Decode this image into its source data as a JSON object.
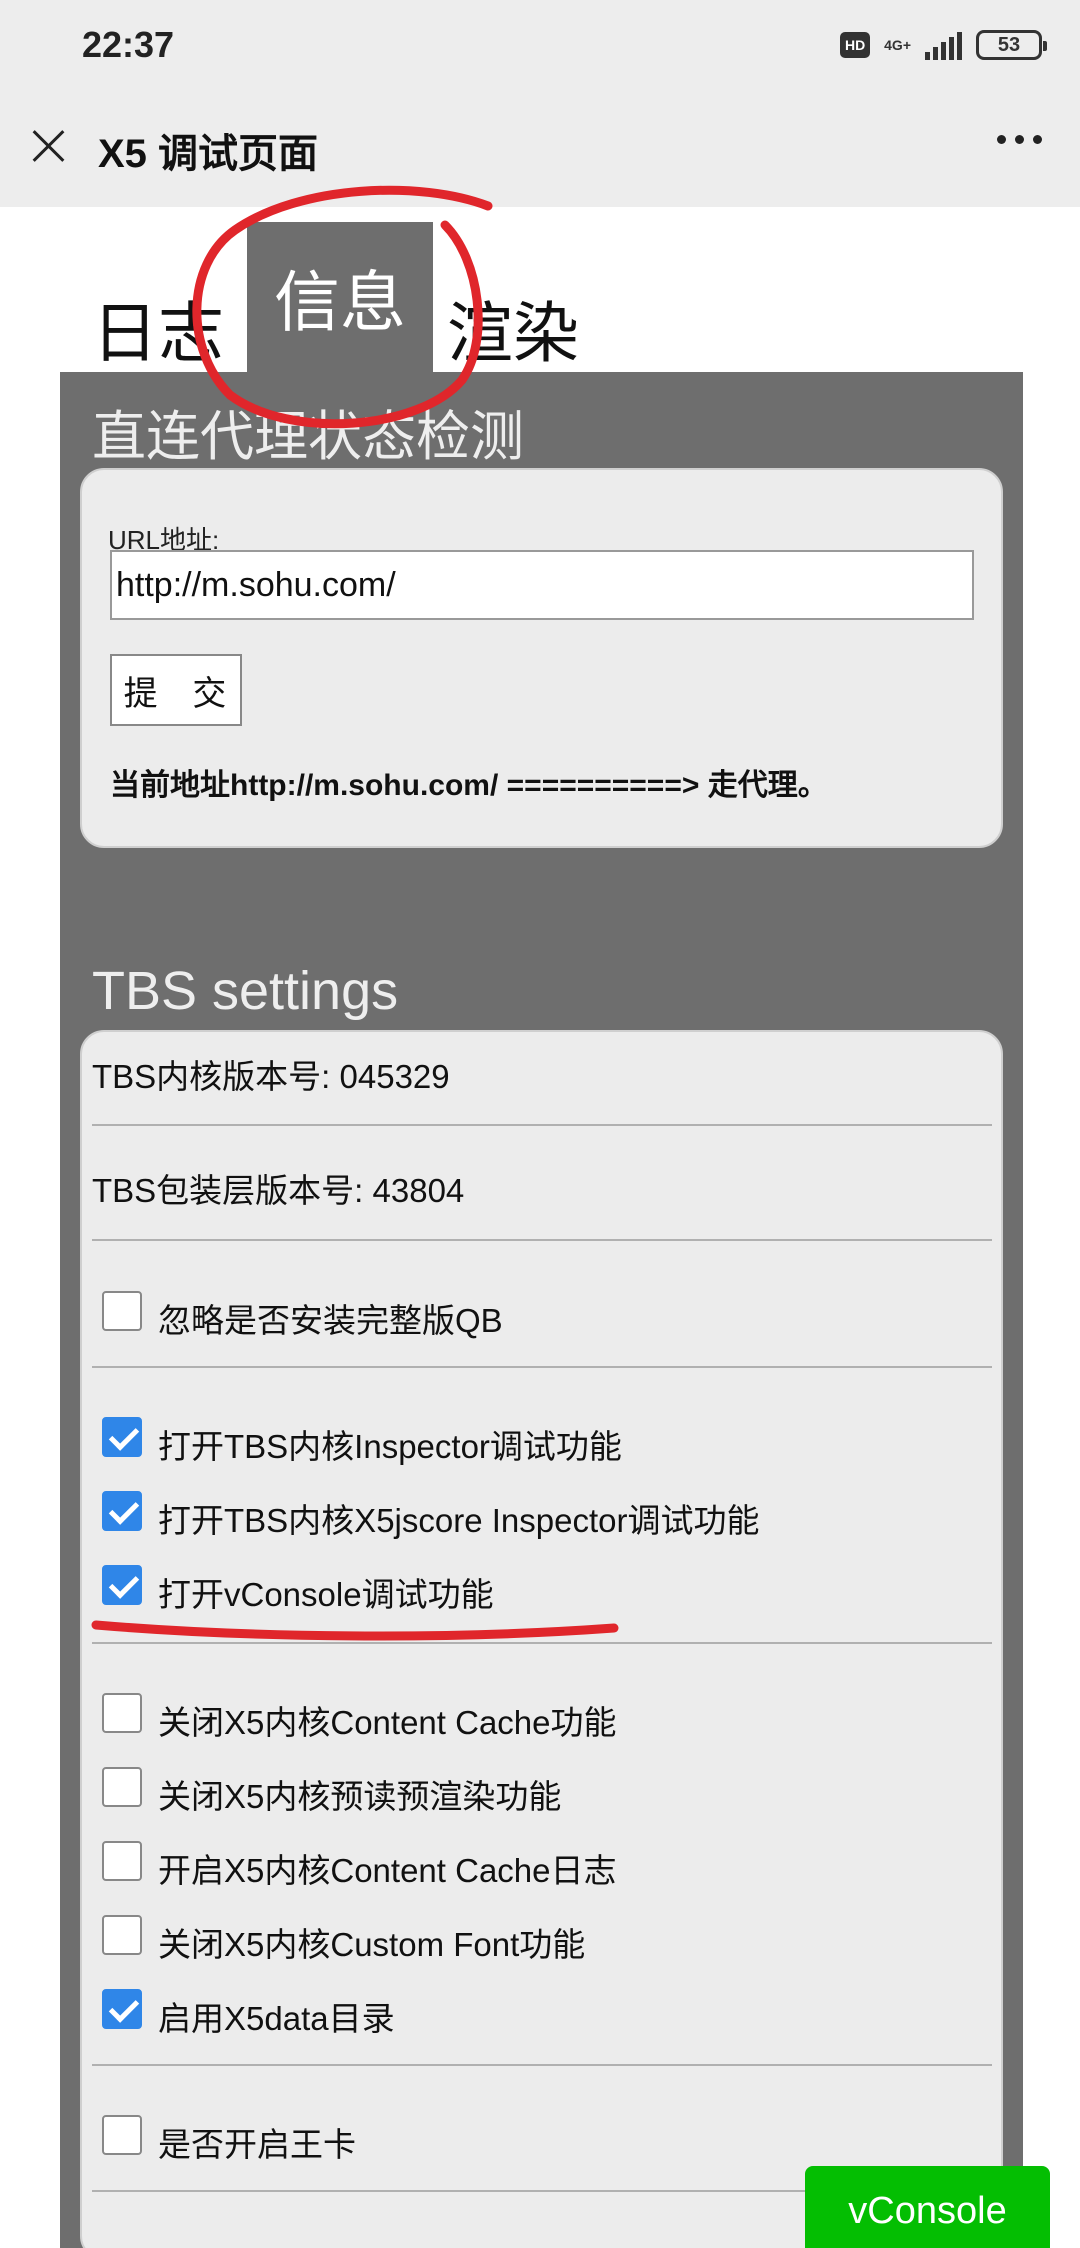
{
  "status_bar": {
    "time": "22:37",
    "hd": "HD",
    "network": "4G+",
    "battery": "53"
  },
  "titlebar": {
    "title": "X5 调试页面",
    "close_icon": "close-icon",
    "more_icon": "more-dots-icon"
  },
  "tabs": [
    {
      "label": "日志",
      "active": false
    },
    {
      "label": "信息",
      "active": true
    },
    {
      "label": "渲染",
      "active": false
    }
  ],
  "proxy_section": {
    "title": "直连代理状态检测",
    "url_label": "URL地址:",
    "url_value": "http://m.sohu.com/",
    "submit_label": "提 交",
    "result": "当前地址http://m.sohu.com/ ==========> 走代理。"
  },
  "tbs_section": {
    "title": "TBS settings",
    "core_version": "TBS内核版本号: 045329",
    "wrapper_version": "TBS包装层版本号: 43804",
    "group1": [
      {
        "label": "忽略是否安装完整版QB",
        "checked": false
      }
    ],
    "group2": [
      {
        "label": "打开TBS内核Inspector调试功能",
        "checked": true
      },
      {
        "label": "打开TBS内核X5jscore Inspector调试功能",
        "checked": true
      },
      {
        "label": "打开vConsole调试功能",
        "checked": true
      }
    ],
    "group3": [
      {
        "label": "关闭X5内核Content Cache功能",
        "checked": false
      },
      {
        "label": "关闭X5内核预读预渲染功能",
        "checked": false
      },
      {
        "label": "开启X5内核Content Cache日志",
        "checked": false
      },
      {
        "label": "关闭X5内核Custom Font功能",
        "checked": false
      },
      {
        "label": "启用X5data目录",
        "checked": true
      }
    ],
    "group4": [
      {
        "label": "是否开启王卡",
        "checked": false
      }
    ]
  },
  "vconsole": {
    "label": "vConsole",
    "color": "#04be02"
  },
  "annotation_color": "#e0262b"
}
